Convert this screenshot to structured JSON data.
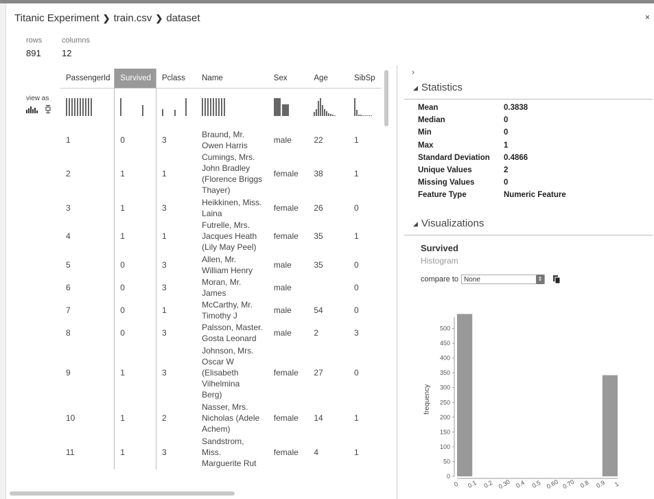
{
  "breadcrumb": [
    "Titanic Experiment",
    "train.csv",
    "dataset"
  ],
  "close_label": "×",
  "summary": {
    "rows_label": "rows",
    "rows_value": "891",
    "columns_label": "columns",
    "columns_value": "12"
  },
  "view_as_label": "view as",
  "columns": [
    "PassengerId",
    "Survived",
    "Pclass",
    "Name",
    "Sex",
    "Age",
    "SibSp"
  ],
  "selected_column": "Survived",
  "rows": [
    {
      "id": "1",
      "survived": "0",
      "pclass": "3",
      "name": "Braund, Mr. Owen Harris",
      "name_lines": [
        "Braund, Mr.",
        "Owen Harris"
      ],
      "sex": "male",
      "age": "22",
      "sibsp": "1"
    },
    {
      "id": "2",
      "survived": "1",
      "pclass": "1",
      "name": "Cumings, Mrs. John Bradley (Florence Briggs Thayer)",
      "name_lines": [
        "Cumings, Mrs.",
        "John Bradley",
        "(Florence Briggs",
        "Thayer)"
      ],
      "sex": "female",
      "age": "38",
      "sibsp": "1"
    },
    {
      "id": "3",
      "survived": "1",
      "pclass": "3",
      "name": "Heikkinen, Miss. Laina",
      "name_lines": [
        "Heikkinen, Miss.",
        "Laina"
      ],
      "sex": "female",
      "age": "26",
      "sibsp": "0"
    },
    {
      "id": "4",
      "survived": "1",
      "pclass": "1",
      "name": "Futrelle, Mrs. Jacques Heath (Lily May Peel)",
      "name_lines": [
        "Futrelle, Mrs.",
        "Jacques Heath",
        "(Lily May Peel)"
      ],
      "sex": "female",
      "age": "35",
      "sibsp": "1"
    },
    {
      "id": "5",
      "survived": "0",
      "pclass": "3",
      "name": "Allen, Mr. William Henry",
      "name_lines": [
        "Allen, Mr.",
        "William Henry"
      ],
      "sex": "male",
      "age": "35",
      "sibsp": "0"
    },
    {
      "id": "6",
      "survived": "0",
      "pclass": "3",
      "name": "Moran, Mr. James",
      "name_lines": [
        "Moran, Mr.",
        "James"
      ],
      "sex": "male",
      "age": "",
      "sibsp": "0"
    },
    {
      "id": "7",
      "survived": "0",
      "pclass": "1",
      "name": "McCarthy, Mr. Timothy J",
      "name_lines": [
        "McCarthy, Mr.",
        "Timothy J"
      ],
      "sex": "male",
      "age": "54",
      "sibsp": "0"
    },
    {
      "id": "8",
      "survived": "0",
      "pclass": "3",
      "name": "Palsson, Master. Gosta Leonard",
      "name_lines": [
        "Palsson, Master.",
        "Gosta Leonard"
      ],
      "sex": "male",
      "age": "2",
      "sibsp": "3"
    },
    {
      "id": "9",
      "survived": "1",
      "pclass": "3",
      "name": "Johnson, Mrs. Oscar W (Elisabeth Vilhelmina Berg)",
      "name_lines": [
        "Johnson, Mrs.",
        "Oscar W",
        "(Elisabeth",
        "Vilhelmina",
        "Berg)"
      ],
      "sex": "female",
      "age": "27",
      "sibsp": "0"
    },
    {
      "id": "10",
      "survived": "1",
      "pclass": "2",
      "name": "Nasser, Mrs. Nicholas (Adele Achem)",
      "name_lines": [
        "Nasser, Mrs.",
        "Nicholas (Adele",
        "Achem)"
      ],
      "sex": "female",
      "age": "14",
      "sibsp": "1"
    },
    {
      "id": "11",
      "survived": "1",
      "pclass": "3",
      "name": "Sandstrom, Miss. Marguerite Rut",
      "name_lines": [
        "Sandstrom,",
        "Miss.",
        "Marguerite Rut"
      ],
      "sex": "female",
      "age": "4",
      "sibsp": "1"
    }
  ],
  "statistics": {
    "title": "Statistics",
    "items": [
      {
        "label": "Mean",
        "value": "0.3838"
      },
      {
        "label": "Median",
        "value": "0"
      },
      {
        "label": "Min",
        "value": "0"
      },
      {
        "label": "Max",
        "value": "1"
      },
      {
        "label": "Standard Deviation",
        "value": "0.4866"
      },
      {
        "label": "Unique Values",
        "value": "2"
      },
      {
        "label": "Missing Values",
        "value": "0"
      },
      {
        "label": "Feature Type",
        "value": "Numeric Feature"
      }
    ]
  },
  "visualizations": {
    "title": "Visualizations",
    "feature": "Survived",
    "chart_kind": "Histogram",
    "compare_label": "compare to",
    "compare_value": "None"
  },
  "chart_data": {
    "type": "bar",
    "ylabel": "frequency",
    "ylim": [
      0,
      550
    ],
    "yticks": [
      0,
      50,
      100,
      150,
      200,
      250,
      300,
      350,
      400,
      450,
      500
    ],
    "xticks": [
      "0",
      "0.1",
      "0.2",
      "0.30",
      "0.4",
      "0.5",
      "0.60",
      "0.70",
      "0.8",
      "0.9",
      "1"
    ],
    "bins": [
      {
        "x0": 0.0,
        "x1": 0.1,
        "value": 549
      },
      {
        "x0": 0.9,
        "x1": 1.0,
        "value": 342
      }
    ],
    "bar_color": "#999999"
  }
}
